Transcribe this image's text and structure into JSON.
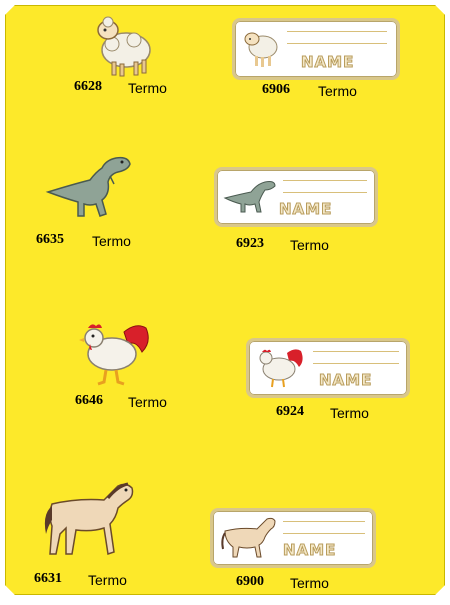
{
  "items": [
    {
      "code": "6628",
      "type": "Termo",
      "animal": "sheep"
    },
    {
      "code": "6906",
      "type": "Termo",
      "animal": "sheep",
      "label_text": "NAME"
    },
    {
      "code": "6635",
      "type": "Termo",
      "animal": "dinosaur"
    },
    {
      "code": "6923",
      "type": "Termo",
      "animal": "dinosaur",
      "label_text": "NAME"
    },
    {
      "code": "6646",
      "type": "Termo",
      "animal": "rooster"
    },
    {
      "code": "6924",
      "type": "Termo",
      "animal": "rooster",
      "label_text": "NAME"
    },
    {
      "code": "6631",
      "type": "Termo",
      "animal": "horse"
    },
    {
      "code": "6900",
      "type": "Termo",
      "animal": "horse",
      "label_text": "NAME"
    }
  ],
  "colors": {
    "background": "#fde92a",
    "patch_border": "#d9c78a"
  }
}
